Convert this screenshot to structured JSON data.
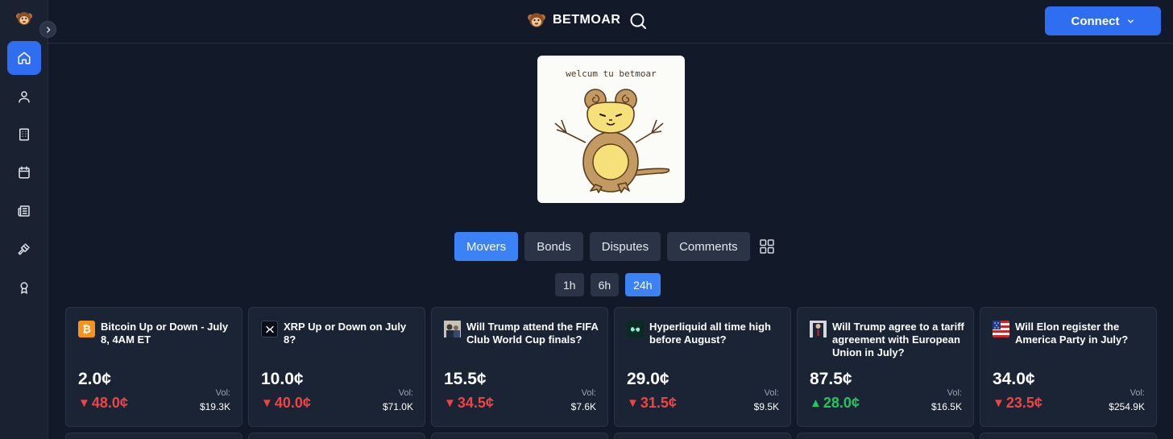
{
  "app": {
    "brand": "BETMOAR"
  },
  "header": {
    "connect_label": "Connect"
  },
  "hero": {
    "caption": "welcum tu betmoar"
  },
  "tabs": [
    {
      "label": "Movers",
      "active": true
    },
    {
      "label": "Bonds",
      "active": false
    },
    {
      "label": "Disputes",
      "active": false
    },
    {
      "label": "Comments",
      "active": false
    }
  ],
  "timeframes": [
    {
      "label": "1h",
      "active": false
    },
    {
      "label": "6h",
      "active": false
    },
    {
      "label": "24h",
      "active": true
    }
  ],
  "cards": [
    {
      "title": "Bitcoin Up or Down - July 8, 4AM ET",
      "icon": "bitcoin-icon",
      "price": "2.0¢",
      "direction": "down",
      "change": "48.0¢",
      "vol_label": "Vol:",
      "vol": "$19.3K"
    },
    {
      "title": "XRP Up or Down on July 8?",
      "icon": "xrp-icon",
      "price": "10.0¢",
      "direction": "down",
      "change": "40.0¢",
      "vol_label": "Vol:",
      "vol": "$71.0K"
    },
    {
      "title": "Will Trump attend the FIFA Club World Cup finals?",
      "icon": "photo-thumbnail",
      "price": "15.5¢",
      "direction": "down",
      "change": "34.5¢",
      "vol_label": "Vol:",
      "vol": "$7.6K"
    },
    {
      "title": "Hyperliquid all time high before August?",
      "icon": "hyperliquid-icon",
      "price": "29.0¢",
      "direction": "down",
      "change": "31.5¢",
      "vol_label": "Vol:",
      "vol": "$9.5K"
    },
    {
      "title": "Will Trump agree to a tariff agreement with European Union in July?",
      "icon": "photo-thumbnail",
      "price": "87.5¢",
      "direction": "up",
      "change": "28.0¢",
      "vol_label": "Vol:",
      "vol": "$16.5K"
    },
    {
      "title": "Will Elon register the America Party in July?",
      "icon": "us-flag-icon",
      "price": "34.0¢",
      "direction": "down",
      "change": "23.5¢",
      "vol_label": "Vol:",
      "vol": "$254.9K"
    }
  ],
  "colors": {
    "accent": "#2f6ef1",
    "tab_active": "#3b82f6",
    "down": "#ef4444",
    "up": "#22c55e",
    "bg": "#121a2a",
    "card": "#1b2434"
  }
}
